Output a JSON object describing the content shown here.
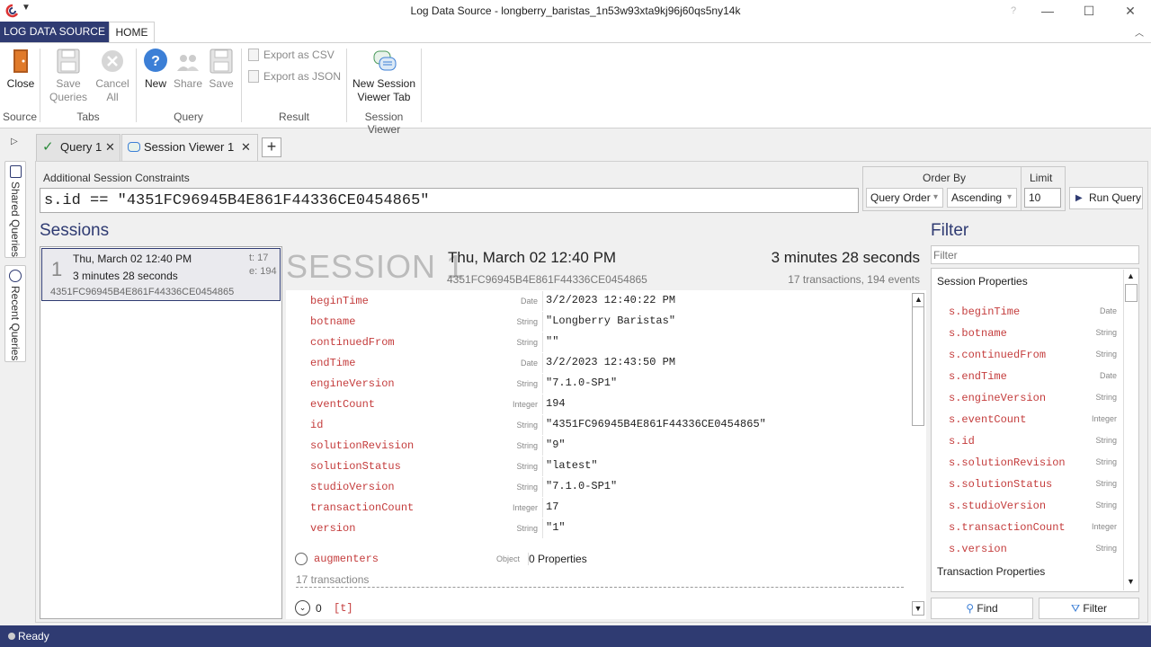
{
  "window": {
    "title": "Log Data Source - longberry_baristas_1n53w93xta9kj96j60qs5ny14k",
    "help": "?",
    "minimize": "—",
    "maximize": "☐",
    "close": "✕"
  },
  "ribbon_tabs": {
    "log_data_source": "LOG DATA SOURCE",
    "home": "HOME"
  },
  "ribbon": {
    "close": "Close",
    "save_queries": [
      "Save",
      "Queries"
    ],
    "cancel_all": [
      "Cancel",
      "All"
    ],
    "new": "New",
    "share": "Share",
    "save": "Save",
    "export_csv": "Export as CSV",
    "export_json": "Export as JSON",
    "new_session_viewer": [
      "New Session",
      "Viewer Tab"
    ],
    "groups": {
      "source": "Source",
      "tabs": "Tabs",
      "query": "Query",
      "result": "Result",
      "session_viewer": "Session Viewer"
    }
  },
  "side_tabs": {
    "shared_queries": "Shared Queries",
    "recent_queries": "Recent Queries"
  },
  "doc_tabs": [
    {
      "label": "Query 1"
    },
    {
      "label": "Session Viewer 1"
    }
  ],
  "constraints": {
    "label": "Additional Session Constraints",
    "value": "s.id == \"4351FC96945B4E861F44336CE0454865\""
  },
  "order_by": {
    "label": "Order By",
    "field": "Query Order",
    "direction": "Ascending"
  },
  "limit": {
    "label": "Limit",
    "value": "10"
  },
  "run_query": "Run Query",
  "sessions": {
    "title": "Sessions",
    "items": [
      {
        "index": "1",
        "date": "Thu, March 02 12:40 PM",
        "duration": "3 minutes 28 seconds",
        "t": "t: 17",
        "e": "e: 194",
        "id": "4351FC96945B4E861F44336CE0454865"
      }
    ]
  },
  "session": {
    "label": "SESSION 1",
    "date": "Thu, March 02 12:40 PM",
    "duration": "3 minutes 28 seconds",
    "id": "4351FC96945B4E861F44336CE0454865",
    "counts": "17 transactions, 194 events",
    "properties": [
      {
        "name": "beginTime",
        "type": "Date",
        "value": "3/2/2023 12:40:22 PM"
      },
      {
        "name": "botname",
        "type": "String",
        "value": "\"Longberry Baristas\""
      },
      {
        "name": "continuedFrom",
        "type": "String",
        "value": "\"\""
      },
      {
        "name": "endTime",
        "type": "Date",
        "value": "3/2/2023 12:43:50 PM"
      },
      {
        "name": "engineVersion",
        "type": "String",
        "value": "\"7.1.0-SP1\""
      },
      {
        "name": "eventCount",
        "type": "Integer",
        "value": "194"
      },
      {
        "name": "id",
        "type": "String",
        "value": "\"4351FC96945B4E861F44336CE0454865\""
      },
      {
        "name": "solutionRevision",
        "type": "String",
        "value": "\"9\""
      },
      {
        "name": "solutionStatus",
        "type": "String",
        "value": "\"latest\""
      },
      {
        "name": "studioVersion",
        "type": "String",
        "value": "\"7.1.0-SP1\""
      },
      {
        "name": "transactionCount",
        "type": "Integer",
        "value": "17"
      },
      {
        "name": "version",
        "type": "String",
        "value": "\"1\""
      }
    ],
    "augmenters": {
      "name": "augmenters",
      "type": "Object",
      "value": "0 Properties"
    },
    "transactions_label": "17 transactions",
    "transaction_row": {
      "index": "0",
      "tag": "[t]"
    }
  },
  "filter": {
    "title": "Filter",
    "placeholder": "Filter",
    "session_properties_header": "Session Properties",
    "transaction_properties_header": "Transaction Properties",
    "properties": [
      {
        "name": "s.beginTime",
        "type": "Date"
      },
      {
        "name": "s.botname",
        "type": "String"
      },
      {
        "name": "s.continuedFrom",
        "type": "String"
      },
      {
        "name": "s.endTime",
        "type": "Date"
      },
      {
        "name": "s.engineVersion",
        "type": "String"
      },
      {
        "name": "s.eventCount",
        "type": "Integer"
      },
      {
        "name": "s.id",
        "type": "String"
      },
      {
        "name": "s.solutionRevision",
        "type": "String"
      },
      {
        "name": "s.solutionStatus",
        "type": "String"
      },
      {
        "name": "s.studioVersion",
        "type": "String"
      },
      {
        "name": "s.transactionCount",
        "type": "Integer"
      },
      {
        "name": "s.version",
        "type": "String"
      }
    ],
    "find": "Find",
    "filter_button": "Filter"
  },
  "status": {
    "text": "Ready"
  },
  "colors": {
    "accent": "#2f3b72",
    "property": "#c43c3c",
    "status_bar": "#2f3b72"
  }
}
